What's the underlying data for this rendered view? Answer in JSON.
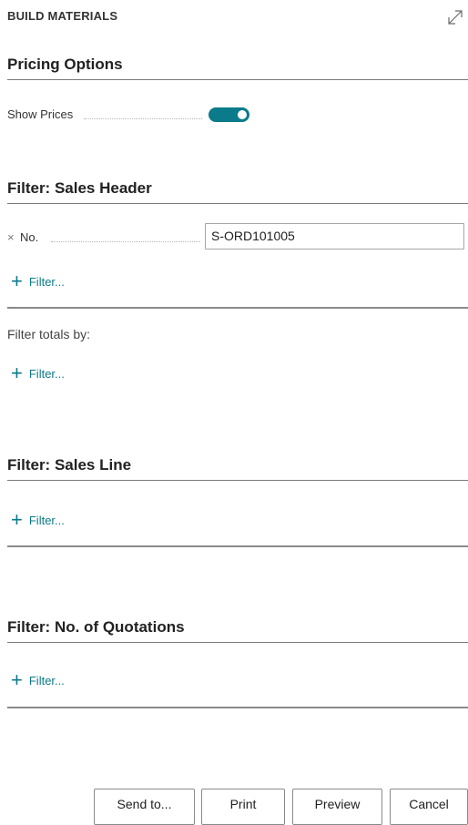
{
  "dialog": {
    "title": "BUILD MATERIALS"
  },
  "pricing": {
    "title": "Pricing Options",
    "show_prices_label": "Show Prices",
    "show_prices_on": true
  },
  "sales_header": {
    "title": "Filter: Sales Header",
    "field_label": "No.",
    "field_remove_glyph": "×",
    "field_value": "S-ORD101005",
    "add_filter_label": "Filter..."
  },
  "totals": {
    "label": "Filter totals by:",
    "add_filter_label": "Filter..."
  },
  "sales_line": {
    "title": "Filter: Sales Line",
    "add_filter_label": "Filter..."
  },
  "quotations": {
    "title": "Filter: No. of Quotations",
    "add_filter_label": "Filter..."
  },
  "buttons": {
    "send_to": "Send to...",
    "print": "Print",
    "preview": "Preview",
    "cancel": "Cancel"
  },
  "icons": {
    "expand": "expand-diagonal-icon",
    "add": "plus-icon",
    "remove": "close-x-icon"
  },
  "colors": {
    "accent": "#0b7b8b",
    "text": "#212121"
  }
}
